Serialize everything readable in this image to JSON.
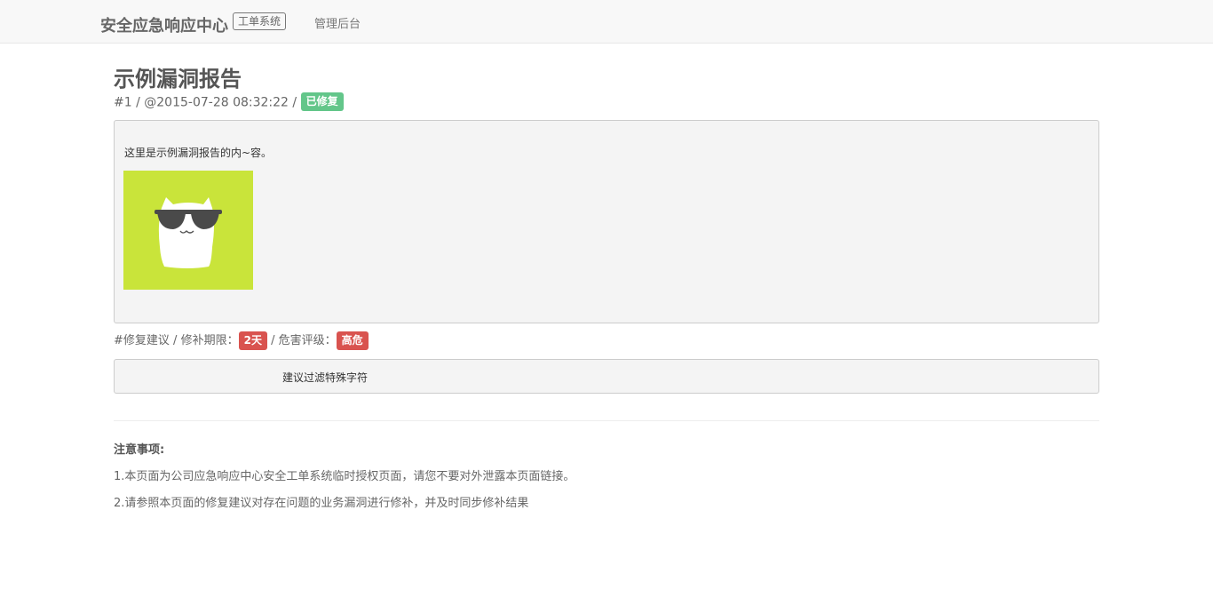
{
  "navbar": {
    "brand": "安全应急响应中心",
    "brand_tag": "工单系统",
    "links": [
      "管理后台"
    ]
  },
  "report": {
    "title": "示例漏洞报告",
    "id": "#1",
    "separator1": "/",
    "timestamp": "@2015-07-28 08:32:22",
    "separator2": "/",
    "status": "已修复",
    "status_color": "#63c68a",
    "content_text": "这里是示例漏洞报告的内~容。",
    "image_bg_color": "#c9e43a"
  },
  "fix": {
    "label": "#修复建议",
    "separator": "/",
    "deadline_label": "修补期限：",
    "deadline_value": "2天",
    "separator2": "/",
    "severity_label": "危害评级：",
    "severity_value": "高危",
    "danger_color": "#d9534f",
    "suggestion": "建议过滤特殊字符"
  },
  "notice": {
    "title": "注意事项:",
    "items": [
      "1.本页面为公司应急响应中心安全工单系统临时授权页面，请您不要对外泄露本页面链接。",
      "2.请参照本页面的修复建议对存在问题的业务漏洞进行修补，并及时同步修补结果"
    ]
  }
}
